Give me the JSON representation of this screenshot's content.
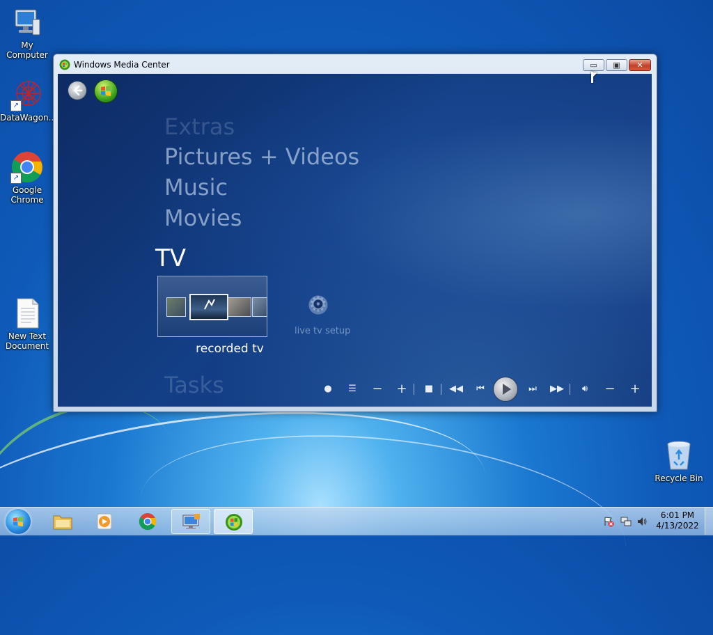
{
  "desktop": {
    "icons": [
      {
        "label": "My Computer",
        "icon": "computer-icon"
      },
      {
        "label": "DataWagon...",
        "icon": "datawagon-icon"
      },
      {
        "label": "Google Chrome",
        "icon": "chrome-icon"
      },
      {
        "label": "New Text Document",
        "icon": "text-document-icon"
      },
      {
        "label": "Recycle Bin",
        "icon": "recycle-bin-icon"
      }
    ]
  },
  "window": {
    "title": "Windows Media Center",
    "controls": {
      "minimize": "minimize",
      "maximize": "maximize",
      "close": "close"
    }
  },
  "media_center": {
    "menu": [
      "Extras",
      "Pictures + Videos",
      "Music",
      "Movies"
    ],
    "active_section": "TV",
    "strip_items": [
      {
        "label": "recorded tv",
        "icon": "recorded-tv-thumbnails"
      },
      {
        "label": "live tv setup",
        "icon": "gear-icon"
      }
    ],
    "next_section": "Tasks",
    "transport_controls": [
      "record",
      "guide",
      "channel-down",
      "channel-up",
      "stop",
      "rewind",
      "previous",
      "play",
      "next",
      "fast-forward",
      "mute",
      "volume-down",
      "volume-up"
    ]
  },
  "taskbar": {
    "pinned": [
      "start-orb",
      "file-explorer-icon",
      "media-player-icon",
      "chrome-icon",
      "remote-desktop-icon",
      "media-center-icon"
    ],
    "tray": [
      "action-center-icon",
      "network-icon",
      "volume-icon"
    ],
    "time": "6:01 PM",
    "date": "4/13/2022"
  }
}
